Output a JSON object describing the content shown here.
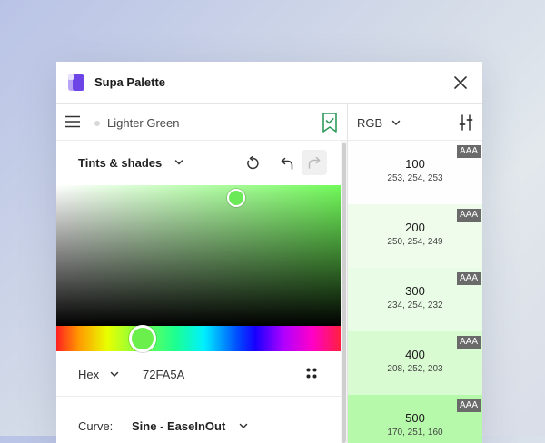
{
  "app": {
    "title": "Supa Palette"
  },
  "toolbar": {
    "color_name": "Lighter Green"
  },
  "tints": {
    "label": "Tints & shades"
  },
  "format": {
    "label": "Hex",
    "value": "72FA5A"
  },
  "curve": {
    "label": "Curve:",
    "value": "Sine - EaseInOut"
  },
  "picker": {
    "base_color": "#72fa5a",
    "hue_color": "#6bef4d"
  },
  "right_panel": {
    "model_label": "RGB",
    "swatches": [
      {
        "step": "100",
        "rgb": "253, 254, 253",
        "badge": "AAA",
        "color": "#fdfefd"
      },
      {
        "step": "200",
        "rgb": "250, 254, 249",
        "badge": "AAA",
        "color": "#effcec"
      },
      {
        "step": "300",
        "rgb": "234, 254, 232",
        "badge": "AAA",
        "color": "#e9fde6"
      },
      {
        "step": "400",
        "rgb": "208, 252, 203",
        "badge": "AAA",
        "color": "#d9fbd2"
      },
      {
        "step": "500",
        "rgb": "170, 251, 160",
        "badge": "AAA",
        "color": "#b7f9ab"
      }
    ]
  },
  "icons": {
    "logo": "app-logo-icon",
    "close": "close-icon",
    "menu": "menu-icon",
    "bookmark": "bookmark-check-icon",
    "reset": "reset-icon",
    "undo": "undo-icon",
    "redo": "redo-icon",
    "grid": "grid-dots-icon",
    "adjust": "sliders-icon",
    "chevron": "chevron-down-icon"
  }
}
